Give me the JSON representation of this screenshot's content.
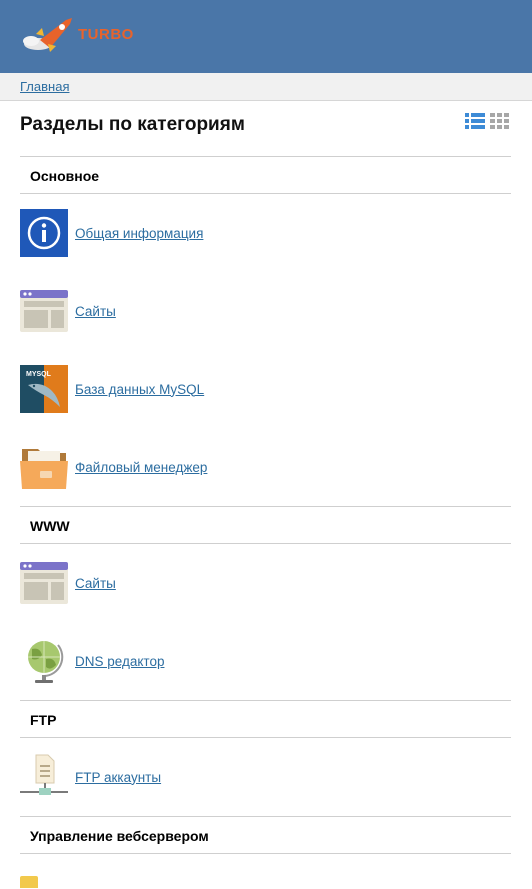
{
  "header": {
    "logo_text": "TURBO"
  },
  "breadcrumb": {
    "home": "Главная"
  },
  "page": {
    "title": "Разделы по категориям"
  },
  "sections": [
    {
      "title": "Основное",
      "items": [
        {
          "label": "Общая информация",
          "icon": "info-icon"
        },
        {
          "label": "Сайты",
          "icon": "sites-window-icon"
        },
        {
          "label": "База данных MySQL",
          "icon": "mysql-database-icon"
        },
        {
          "label": "Файловый менеджер",
          "icon": "folder-icon"
        }
      ]
    },
    {
      "title": "WWW",
      "items": [
        {
          "label": "Сайты",
          "icon": "sites-window-icon"
        },
        {
          "label": "DNS редактор",
          "icon": "globe-icon"
        }
      ]
    },
    {
      "title": "FTP",
      "items": [
        {
          "label": "FTP аккаунты",
          "icon": "ftp-network-icon"
        }
      ]
    },
    {
      "title": "Управление вебсервером",
      "items": []
    }
  ],
  "colors": {
    "header_bg": "#4a76a8",
    "link": "#2c6da0",
    "logo_text": "#e8632b"
  }
}
